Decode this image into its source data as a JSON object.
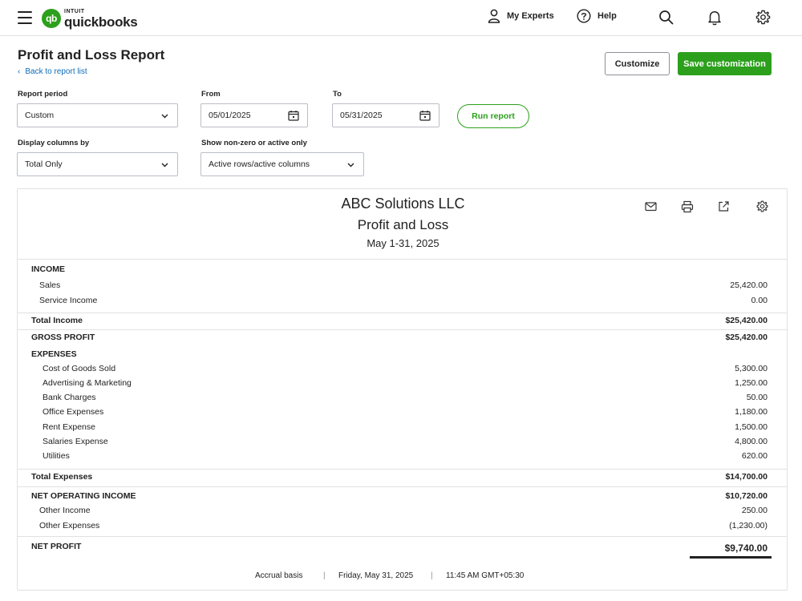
{
  "nav": {
    "brand_small": "INTUIT",
    "brand_name": "quickbooks",
    "brand_mark": "qb",
    "my_experts": "My Experts",
    "help": "Help"
  },
  "header": {
    "title": "Profit and Loss Report",
    "back_link": "Back to report list",
    "customize_label": "Customize",
    "save_label": "Save customization"
  },
  "filters": {
    "report_period_label": "Report period",
    "report_period_value": "Custom",
    "from_label": "From",
    "from_value": "05/01/2025",
    "to_label": "To",
    "to_value": "05/31/2025",
    "run_label": "Run report",
    "display_columns_label": "Display columns by",
    "display_columns_value": "Total Only",
    "nonzero_label": "Show non-zero or active only",
    "nonzero_value": "Active rows/active columns"
  },
  "report": {
    "company": "ABC Solutions LLC",
    "title": "Profit and Loss",
    "date_range": "May 1-31, 2025",
    "income_header": "INCOME",
    "income_rows": [
      {
        "label": "Sales",
        "amount": "25,420.00"
      },
      {
        "label": "Service Income",
        "amount": "0.00"
      }
    ],
    "total_income_label": "Total Income",
    "total_income": "$25,420.00",
    "gross_profit_label": "GROSS PROFIT",
    "gross_profit": "$25,420.00",
    "expenses_header": "EXPENSES",
    "expense_rows": [
      {
        "label": "Cost of Goods Sold",
        "amount": "5,300.00"
      },
      {
        "label": "Advertising & Marketing",
        "amount": "1,250.00"
      },
      {
        "label": "Bank Charges",
        "amount": "50.00"
      },
      {
        "label": "Office Expenses",
        "amount": "1,180.00"
      },
      {
        "label": "Rent Expense",
        "amount": "1,500.00"
      },
      {
        "label": "Salaries Expense",
        "amount": "4,800.00"
      },
      {
        "label": "Utilities",
        "amount": "620.00"
      }
    ],
    "total_expenses_label": "Total Expenses",
    "total_expenses": "$14,700.00",
    "noi_label": "NET OPERATING INCOME",
    "noi": "$10,720.00",
    "other_rows": [
      {
        "label": "Other Income",
        "amount": "250.00"
      },
      {
        "label": "Other Expenses",
        "amount": "(1,230.00)"
      }
    ],
    "net_profit_label": "NET PROFIT",
    "net_profit": "$9,740.00",
    "footer": {
      "basis": "Accrual basis",
      "date": "Friday, May 31, 2025",
      "time": "11:45 AM GMT+05:30",
      "separator": "|"
    }
  },
  "icons": {
    "menu": "hamburger-menu-icon",
    "experts": "person-icon",
    "help": "question-circle-icon",
    "search": "search-icon",
    "notifications": "bell-icon",
    "settings": "gear-icon",
    "email": "mail-icon",
    "print": "print-icon",
    "export": "export-icon",
    "report_settings": "gear-icon"
  },
  "colors": {
    "brand_green": "#2ca01c",
    "link_blue": "#0d6bb8",
    "border": "#dfe1e4"
  }
}
